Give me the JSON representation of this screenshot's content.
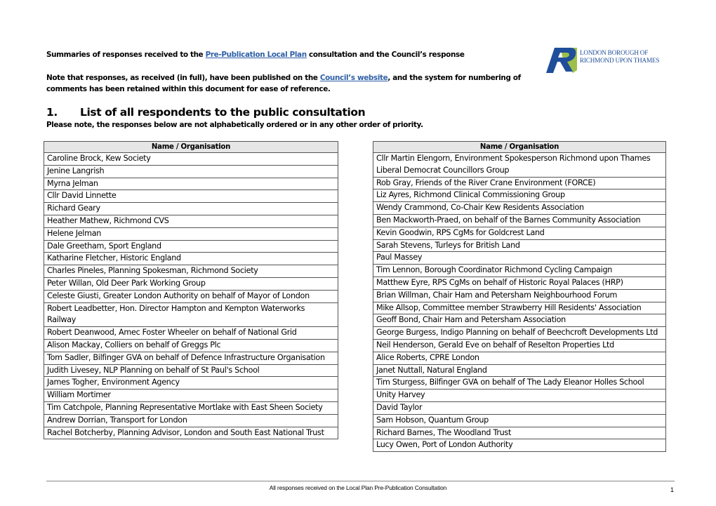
{
  "intro": {
    "line1": {
      "before": "Summaries of responses received to the ",
      "link": "Pre-Publication Local Plan",
      "after": " consultation and the Council’s response"
    },
    "line2": {
      "before": "Note that responses, as received (in full), have been published on the ",
      "link": "Council’s website",
      "after": ", and the system for numbering of comments has been retained within this document for ease of reference."
    }
  },
  "logo": {
    "line1": "LONDON BOROUGH OF",
    "line2": "RICHMOND UPON THAMES",
    "colors": {
      "blue": "#1f4e9a",
      "green": "#9cc04a"
    }
  },
  "section": {
    "number": "1.",
    "title": "List of all respondents to the public consultation",
    "note": "Please note, the responses below are not alphabetically ordered or in any other order of priority."
  },
  "tables": {
    "header": "Name / Organisation",
    "left": [
      "Caroline Brock, Kew Society",
      "Jenine Langrish",
      "Myrna Jelman",
      "Cllr David Linnette",
      "Richard Geary",
      "Heather Mathew, Richmond CVS",
      "Helene Jelman",
      "Dale Greetham, Sport England",
      "Katharine Fletcher, Historic England",
      "Charles Pineles, Planning Spokesman, Richmond Society",
      "Peter Willan, Old Deer Park Working Group",
      "Celeste Giusti, Greater London Authority on behalf of Mayor of London",
      "Robert Leadbetter, Hon. Director Hampton and Kempton Waterworks Railway",
      "Robert Deanwood, Amec Foster Wheeler on behalf of National Grid",
      "Alison Mackay, Colliers on behalf of Greggs Plc",
      "Tom Sadler, Bilfinger GVA on behalf of Defence Infrastructure Organisation",
      "Judith Livesey, NLP Planning on behalf of St Paul's School",
      "James Togher, Environment Agency",
      "William Mortimer",
      "Tim Catchpole, Planning Representative Mortlake with East Sheen Society",
      "Andrew Dorrian, Transport for London",
      "Rachel Botcherby, Planning Advisor, London and South East National Trust"
    ],
    "right": [
      "Cllr Martin Elengorn, Environment Spokesperson Richmond upon Thames Liberal Democrat Councillors Group",
      "Rob Gray, Friends of the River Crane Environment (FORCE)",
      "Liz Ayres, Richmond Clinical Commissioning Group",
      "Wendy Crammond, Co-Chair Kew Residents Association",
      "Ben Mackworth-Praed, on behalf of the Barnes Community Association",
      "Kevin Goodwin, RPS CgMs for Goldcrest Land",
      "Sarah Stevens, Turleys for British Land",
      "Paul Massey",
      "Tim Lennon, Borough Coordinator Richmond Cycling Campaign",
      "Matthew Eyre, RPS CgMs on behalf of Historic Royal Palaces (HRP)",
      "Brian Willman, Chair Ham and Petersham Neighbourhood Forum",
      "Mike Allsop, Committee member Strawberry Hill Residents' Association",
      "Geoff Bond, Chair Ham and Petersham Association",
      "George Burgess, Indigo Planning on behalf of Beechcroft Developments Ltd",
      "Neil Henderson, Gerald Eve on behalf of Reselton Properties Ltd",
      "Alice Roberts, CPRE London",
      "Janet Nuttall, Natural England",
      "Tim Sturgess, Bilfinger GVA on behalf of The Lady Eleanor Holles School",
      "Unity Harvey",
      "David Taylor",
      "Sam Hobson, Quantum Group",
      "Richard Barnes, The Woodland Trust",
      "Lucy Owen, Port of London Authority"
    ]
  },
  "footer": {
    "text": "All responses received on the Local Plan Pre-Publication Consultation",
    "page_number": "1"
  },
  "colors": {
    "link": "#2e5fa6",
    "table_header_bg": "#e6e6e6",
    "table_border": "#555555"
  }
}
